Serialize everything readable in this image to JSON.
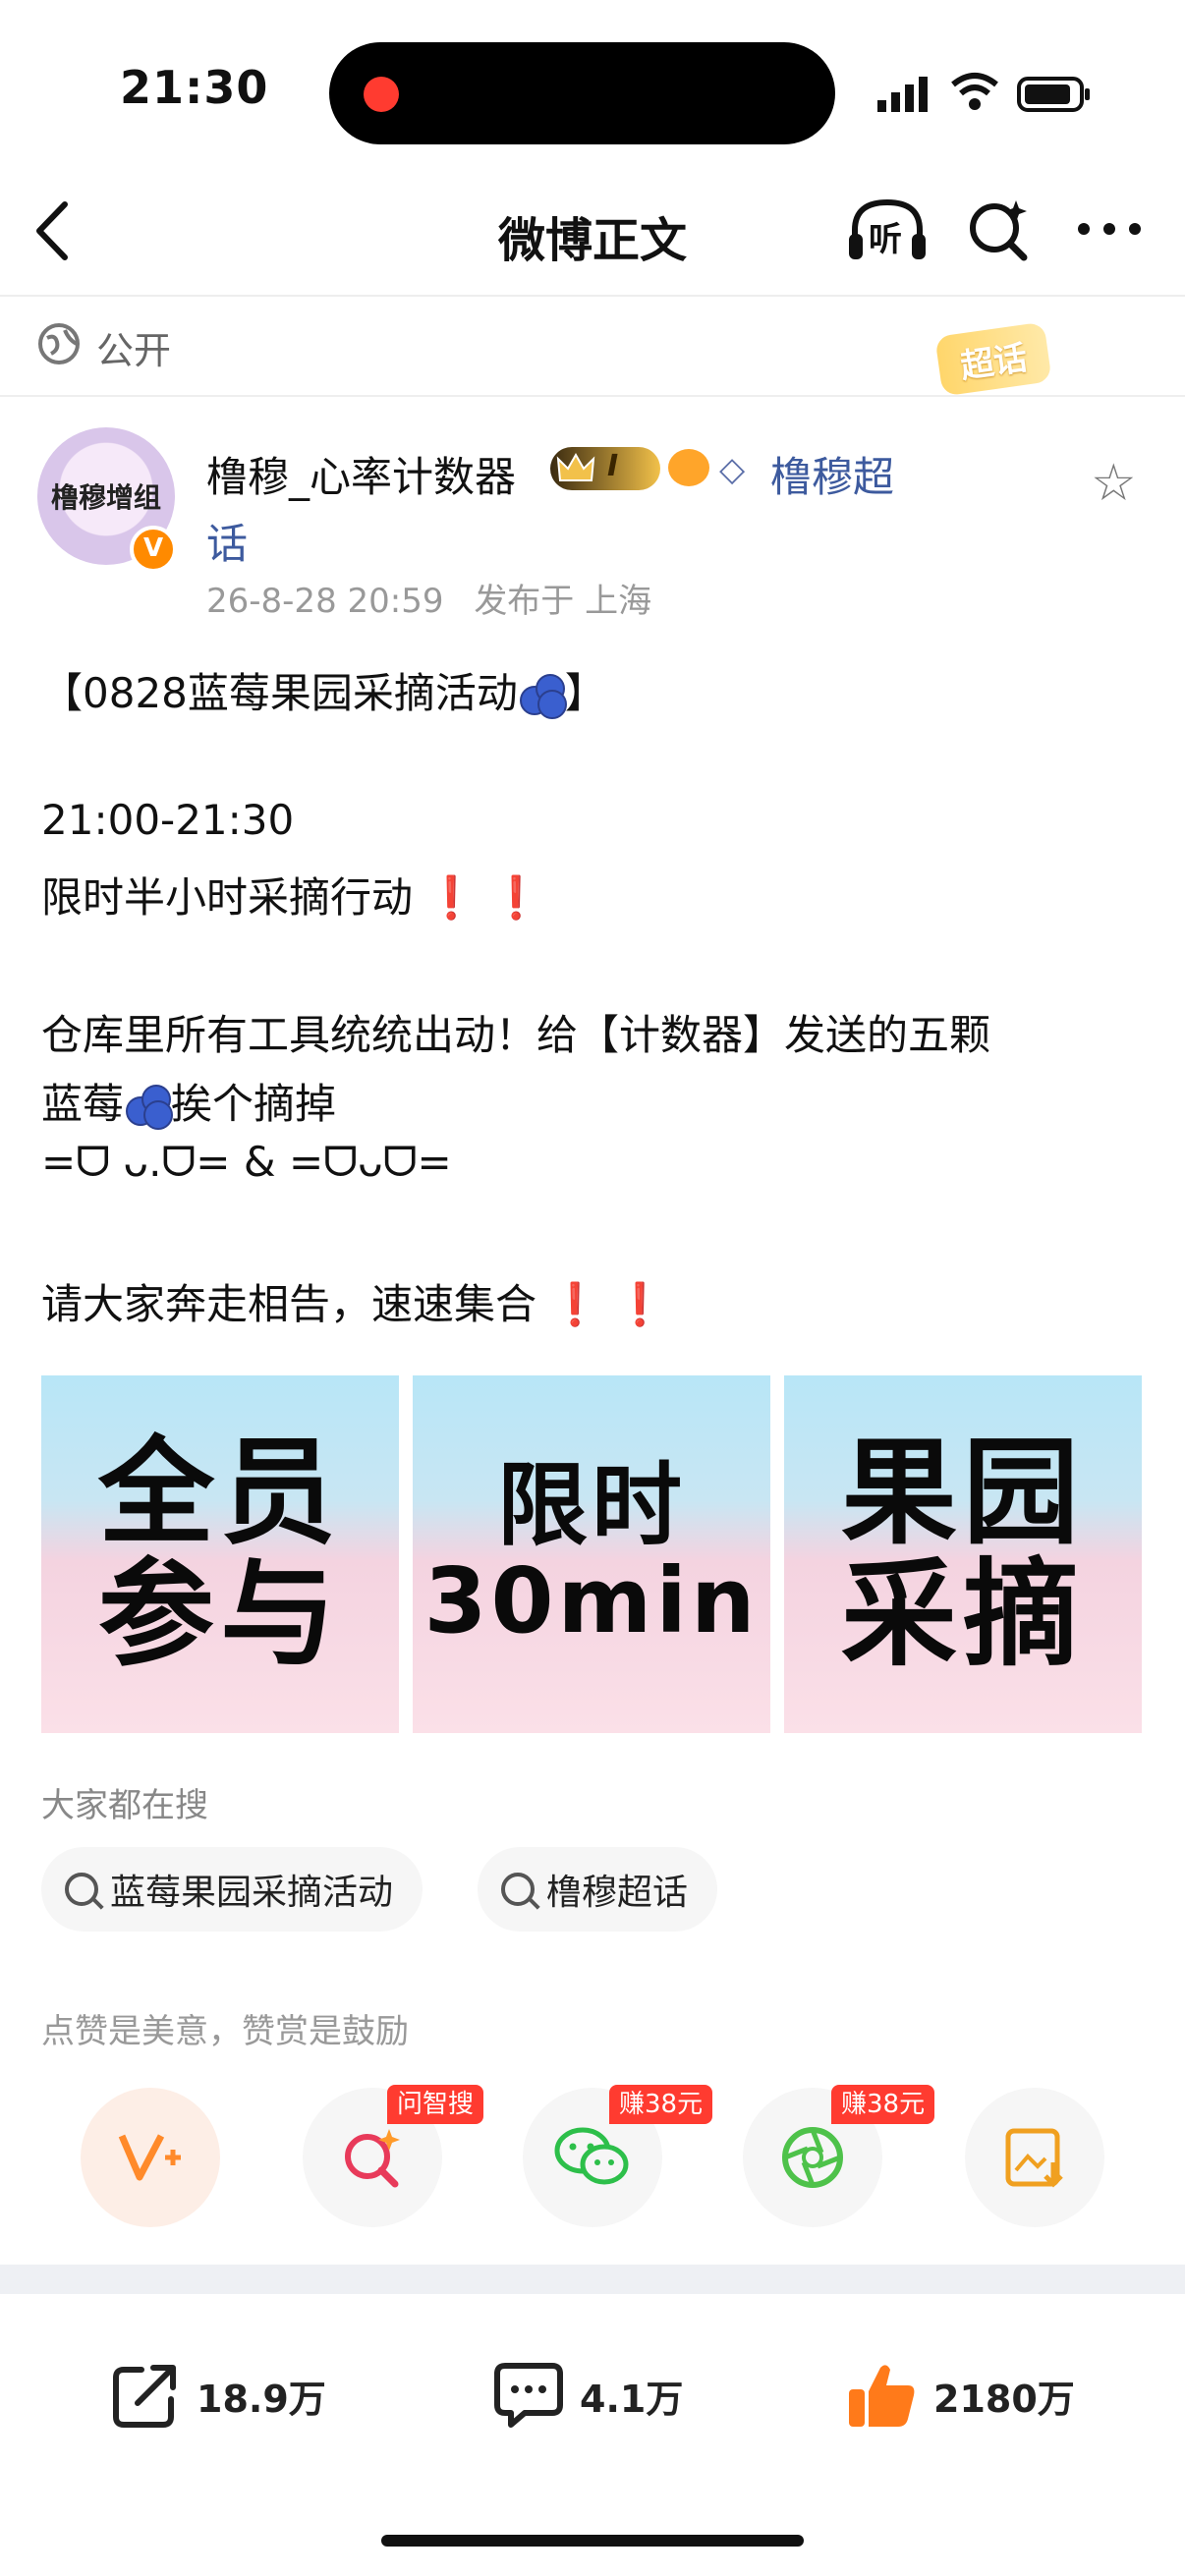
{
  "status": {
    "time": "21:30"
  },
  "nav": {
    "title": "微博正文",
    "listen_label": "听"
  },
  "visibility": {
    "label": "公开",
    "supertopic_badge": "超话"
  },
  "user": {
    "name": "橹穆_心率计数器",
    "level_badge": "I",
    "supertopic_link_a": "橹穆超",
    "supertopic_link_b": "话",
    "datetime": "26-8-28 20:59",
    "location": "发布于 上海",
    "avatar_text": "橹穆增组",
    "avatar_badge": "V"
  },
  "post": {
    "title_open": "【0828蓝莓果园采摘活动",
    "title_close": "】",
    "time_range": "21:00-21:30",
    "line2": "限时半小时采摘行动",
    "line3": "仓库里所有工具统统出动！给【计数器】发送的五颗",
    "line4_a": "蓝莓",
    "line4_b": "挨个摘掉",
    "line5": "=ᗜ ᴗ.ᗜ= & =ᗜᴗᗜ=",
    "line6": "请大家奔走相告，速速集合",
    "bang": "❗"
  },
  "images": [
    {
      "lines": [
        "全员",
        "参与"
      ]
    },
    {
      "lines": [
        "限时",
        "30min"
      ]
    },
    {
      "lines": [
        "果园",
        "采摘"
      ]
    }
  ],
  "search": {
    "label": "大家都在搜",
    "chips": [
      "蓝莓果园采摘活动",
      "橹穆超话"
    ]
  },
  "praise_label": "点赞是美意，赞赏是鼓励",
  "actions": {
    "tags": [
      "问智搜",
      "赚38元",
      "赚38元"
    ]
  },
  "bottom": {
    "repost_count": "18.9万",
    "comment_count": "4.1万",
    "like_count": "2180万"
  },
  "colors": {
    "accent_red": "#e8212a",
    "link_blue": "#3d5a9e",
    "like_orange": "#ff7a1a"
  }
}
